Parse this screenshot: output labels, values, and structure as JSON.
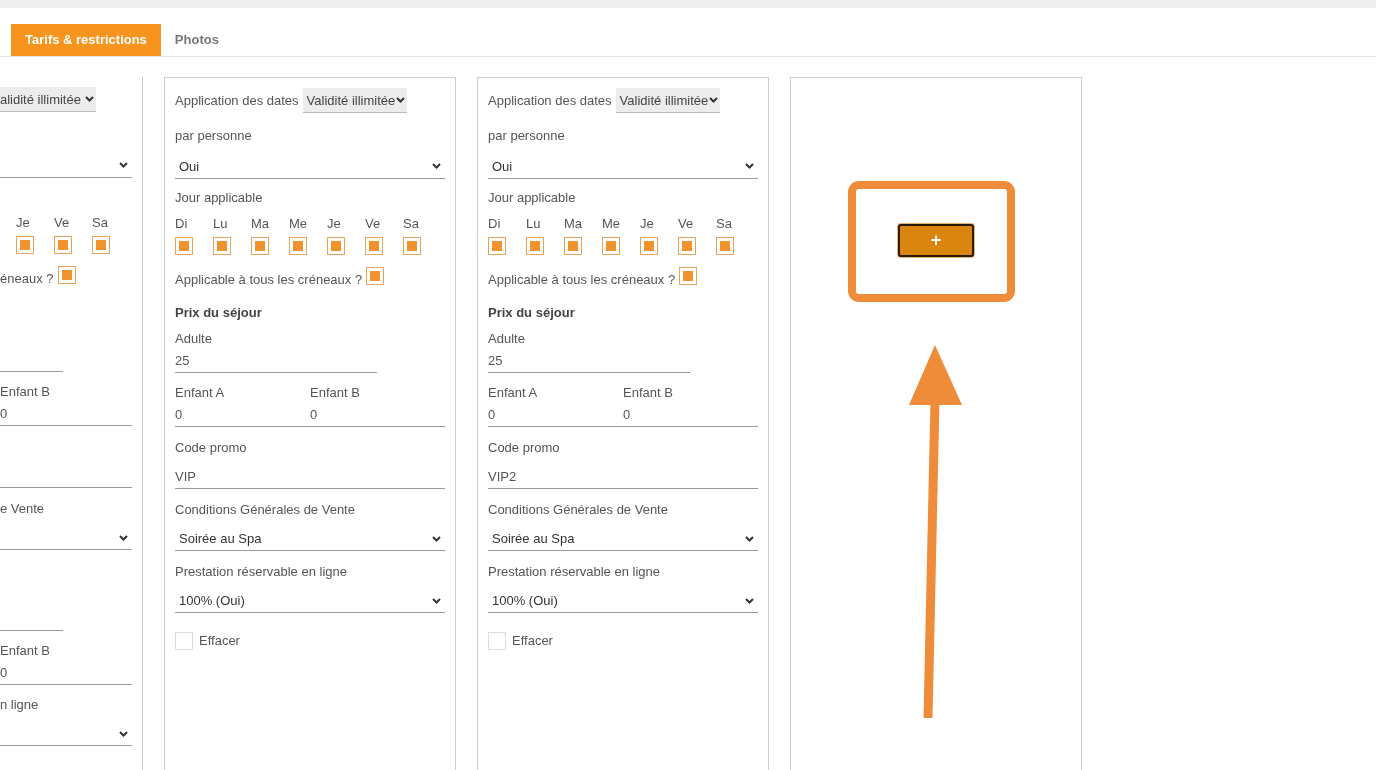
{
  "tabs": [
    {
      "label": "Tarifs & restrictions",
      "selected": true
    },
    {
      "label": "Photos",
      "selected": false
    }
  ],
  "partial_panel": {
    "date_select": "alidité illimitée",
    "days": [
      {
        "label": "Je",
        "checked": true
      },
      {
        "label": "Ve",
        "checked": true
      },
      {
        "label": "Sa",
        "checked": true
      }
    ],
    "all_slots": {
      "label": "éneaux ?",
      "checked": true
    },
    "child_b_1": {
      "label": "Enfant B",
      "value": "0"
    },
    "cgv_label": "e Vente",
    "child_b_2": {
      "label": "Enfant B",
      "value": "0"
    },
    "booking_label": "n ligne"
  },
  "panels": [
    {
      "date_label": "Application des dates",
      "date_select": "Validité illimitée",
      "per_person_label": "par personne",
      "per_person_select": "Oui",
      "days_label": "Jour applicable",
      "days": [
        {
          "label": "Di",
          "checked": true
        },
        {
          "label": "Lu",
          "checked": true
        },
        {
          "label": "Ma",
          "checked": true
        },
        {
          "label": "Me",
          "checked": true
        },
        {
          "label": "Je",
          "checked": true
        },
        {
          "label": "Ve",
          "checked": true
        },
        {
          "label": "Sa",
          "checked": true
        }
      ],
      "all_slots": {
        "label": "Applicable à tous les créneaux ?",
        "checked": true
      },
      "price_heading": "Prix du séjour",
      "adult": {
        "label": "Adulte",
        "value": "25"
      },
      "child_a": {
        "label": "Enfant A",
        "value": "0"
      },
      "child_b": {
        "label": "Enfant B",
        "value": "0"
      },
      "promo": {
        "label": "Code promo",
        "value": "VIP"
      },
      "cgv": {
        "label": "Conditions Générales de Vente",
        "value": "Soirée au Spa"
      },
      "booking": {
        "label": "Prestation réservable en ligne",
        "value": "100% (Oui)"
      },
      "delete": {
        "label": "Effacer",
        "checked": false
      }
    },
    {
      "date_label": "Application des dates",
      "date_select": "Validité illimitée",
      "per_person_label": "par personne",
      "per_person_select": "Oui",
      "days_label": "Jour applicable",
      "days": [
        {
          "label": "Di",
          "checked": true
        },
        {
          "label": "Lu",
          "checked": true
        },
        {
          "label": "Ma",
          "checked": true
        },
        {
          "label": "Me",
          "checked": true
        },
        {
          "label": "Je",
          "checked": true
        },
        {
          "label": "Ve",
          "checked": true
        },
        {
          "label": "Sa",
          "checked": true
        }
      ],
      "all_slots": {
        "label": "Applicable à tous les créneaux ?",
        "checked": true
      },
      "price_heading": "Prix du séjour",
      "adult": {
        "label": "Adulte",
        "value": "25"
      },
      "child_a": {
        "label": "Enfant A",
        "value": "0"
      },
      "child_b": {
        "label": "Enfant B",
        "value": "0"
      },
      "promo": {
        "label": "Code promo",
        "value": "VIP2"
      },
      "cgv": {
        "label": "Conditions Générales de Vente",
        "value": "Soirée au Spa"
      },
      "booking": {
        "label": "Prestation réservable en ligne",
        "value": "100% (Oui)"
      },
      "delete": {
        "label": "Effacer",
        "checked": false
      }
    }
  ],
  "add_button": {
    "label": "+"
  }
}
